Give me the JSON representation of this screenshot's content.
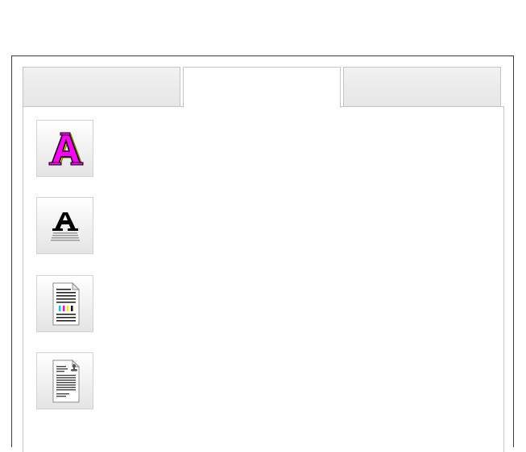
{
  "tabs": [
    {
      "label": ""
    },
    {
      "label": ""
    },
    {
      "label": ""
    }
  ],
  "tools": [
    {
      "icon": "color-text-icon"
    },
    {
      "icon": "text-shadow-icon"
    },
    {
      "icon": "color-document-icon"
    },
    {
      "icon": "document-stamp-icon"
    }
  ],
  "colors": {
    "magenta": "#ff00ff",
    "yellow": "#ffff00",
    "cyan": "#00c8ff",
    "black": "#000000"
  }
}
